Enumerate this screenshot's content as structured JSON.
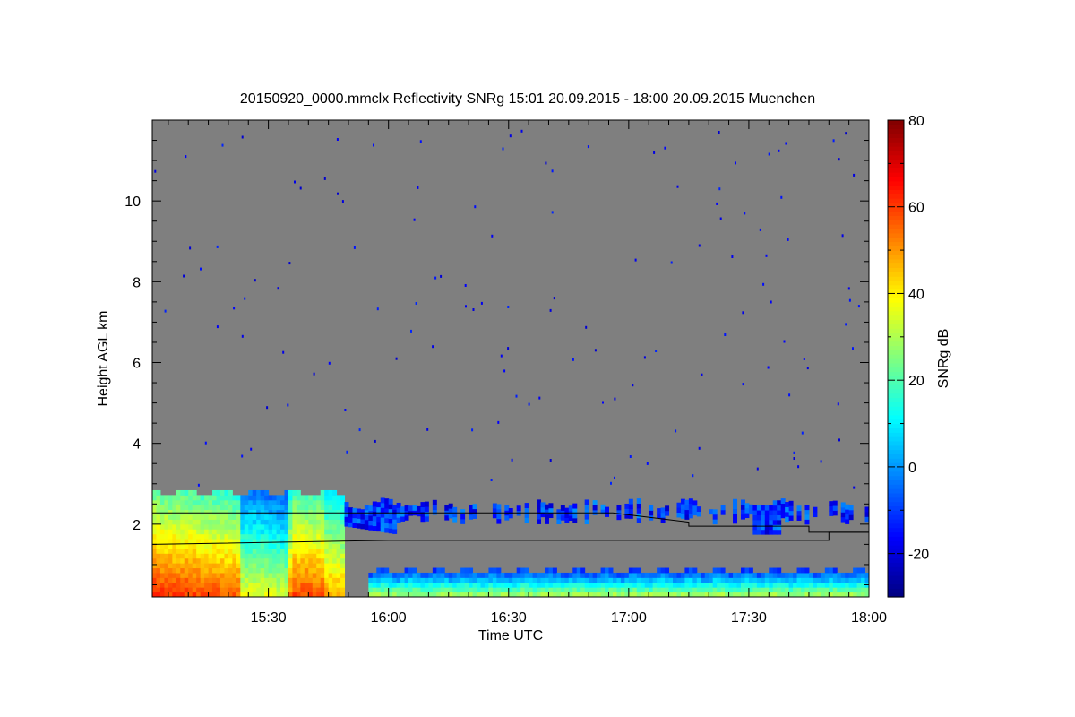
{
  "chart_data": {
    "type": "heatmap",
    "title": "20150920_0000.mmclx Reflectivity SNRg   15:01 20.09.2015 - 18:00 20.09.2015 Muenchen",
    "xlabel": "Time UTC",
    "ylabel": "Height AGL km",
    "x_range_utc": [
      "15:01",
      "18:00"
    ],
    "xlim_minutes_after_midnight": [
      901,
      1080
    ],
    "ylim_km": [
      0.2,
      12.0
    ],
    "x_ticks": [
      {
        "minute": 930,
        "label": "15:30"
      },
      {
        "minute": 960,
        "label": "16:00"
      },
      {
        "minute": 990,
        "label": "16:30"
      },
      {
        "minute": 1020,
        "label": "17:00"
      },
      {
        "minute": 1050,
        "label": "17:30"
      },
      {
        "minute": 1080,
        "label": "18:00"
      }
    ],
    "y_ticks": [
      {
        "value": 2,
        "label": "2"
      },
      {
        "value": 4,
        "label": "4"
      },
      {
        "value": 6,
        "label": "6"
      },
      {
        "value": 8,
        "label": "8"
      },
      {
        "value": 10,
        "label": "10"
      }
    ],
    "colorbar": {
      "label": "SNRg dB",
      "range": [
        -30,
        80
      ],
      "ticks": [
        {
          "value": -20,
          "label": "-20"
        },
        {
          "value": 0,
          "label": "0"
        },
        {
          "value": 20,
          "label": "20"
        },
        {
          "value": 40,
          "label": "40"
        },
        {
          "value": 60,
          "label": "60"
        },
        {
          "value": 80,
          "label": "80"
        }
      ],
      "colormap": "jet"
    },
    "background_color": "#7f7f7f",
    "regions": [
      {
        "name": "rain",
        "x": [
          901,
          949
        ],
        "y": [
          0.2,
          2.8
        ],
        "snr_db": [
          20,
          60
        ]
      },
      {
        "name": "stratiform layer",
        "x": [
          949,
          1080
        ],
        "y": [
          1.8,
          2.5
        ],
        "snr_db": [
          -25,
          5
        ]
      },
      {
        "name": "boundary layer",
        "x": [
          955,
          1080
        ],
        "y": [
          0.2,
          0.8
        ],
        "snr_db": [
          -20,
          30
        ]
      }
    ],
    "lines": [
      {
        "name": "upper",
        "points": [
          [
            901,
            2.28
          ],
          [
            1016,
            2.28
          ],
          [
            1035,
            2.05
          ],
          [
            1035,
            1.95
          ],
          [
            1065,
            1.95
          ],
          [
            1065,
            1.8
          ],
          [
            1080,
            1.8
          ]
        ]
      },
      {
        "name": "lower",
        "points": [
          [
            901,
            1.5
          ],
          [
            960,
            1.6
          ],
          [
            1070,
            1.6
          ],
          [
            1070,
            1.8
          ],
          [
            1080,
            1.8
          ]
        ]
      }
    ]
  }
}
